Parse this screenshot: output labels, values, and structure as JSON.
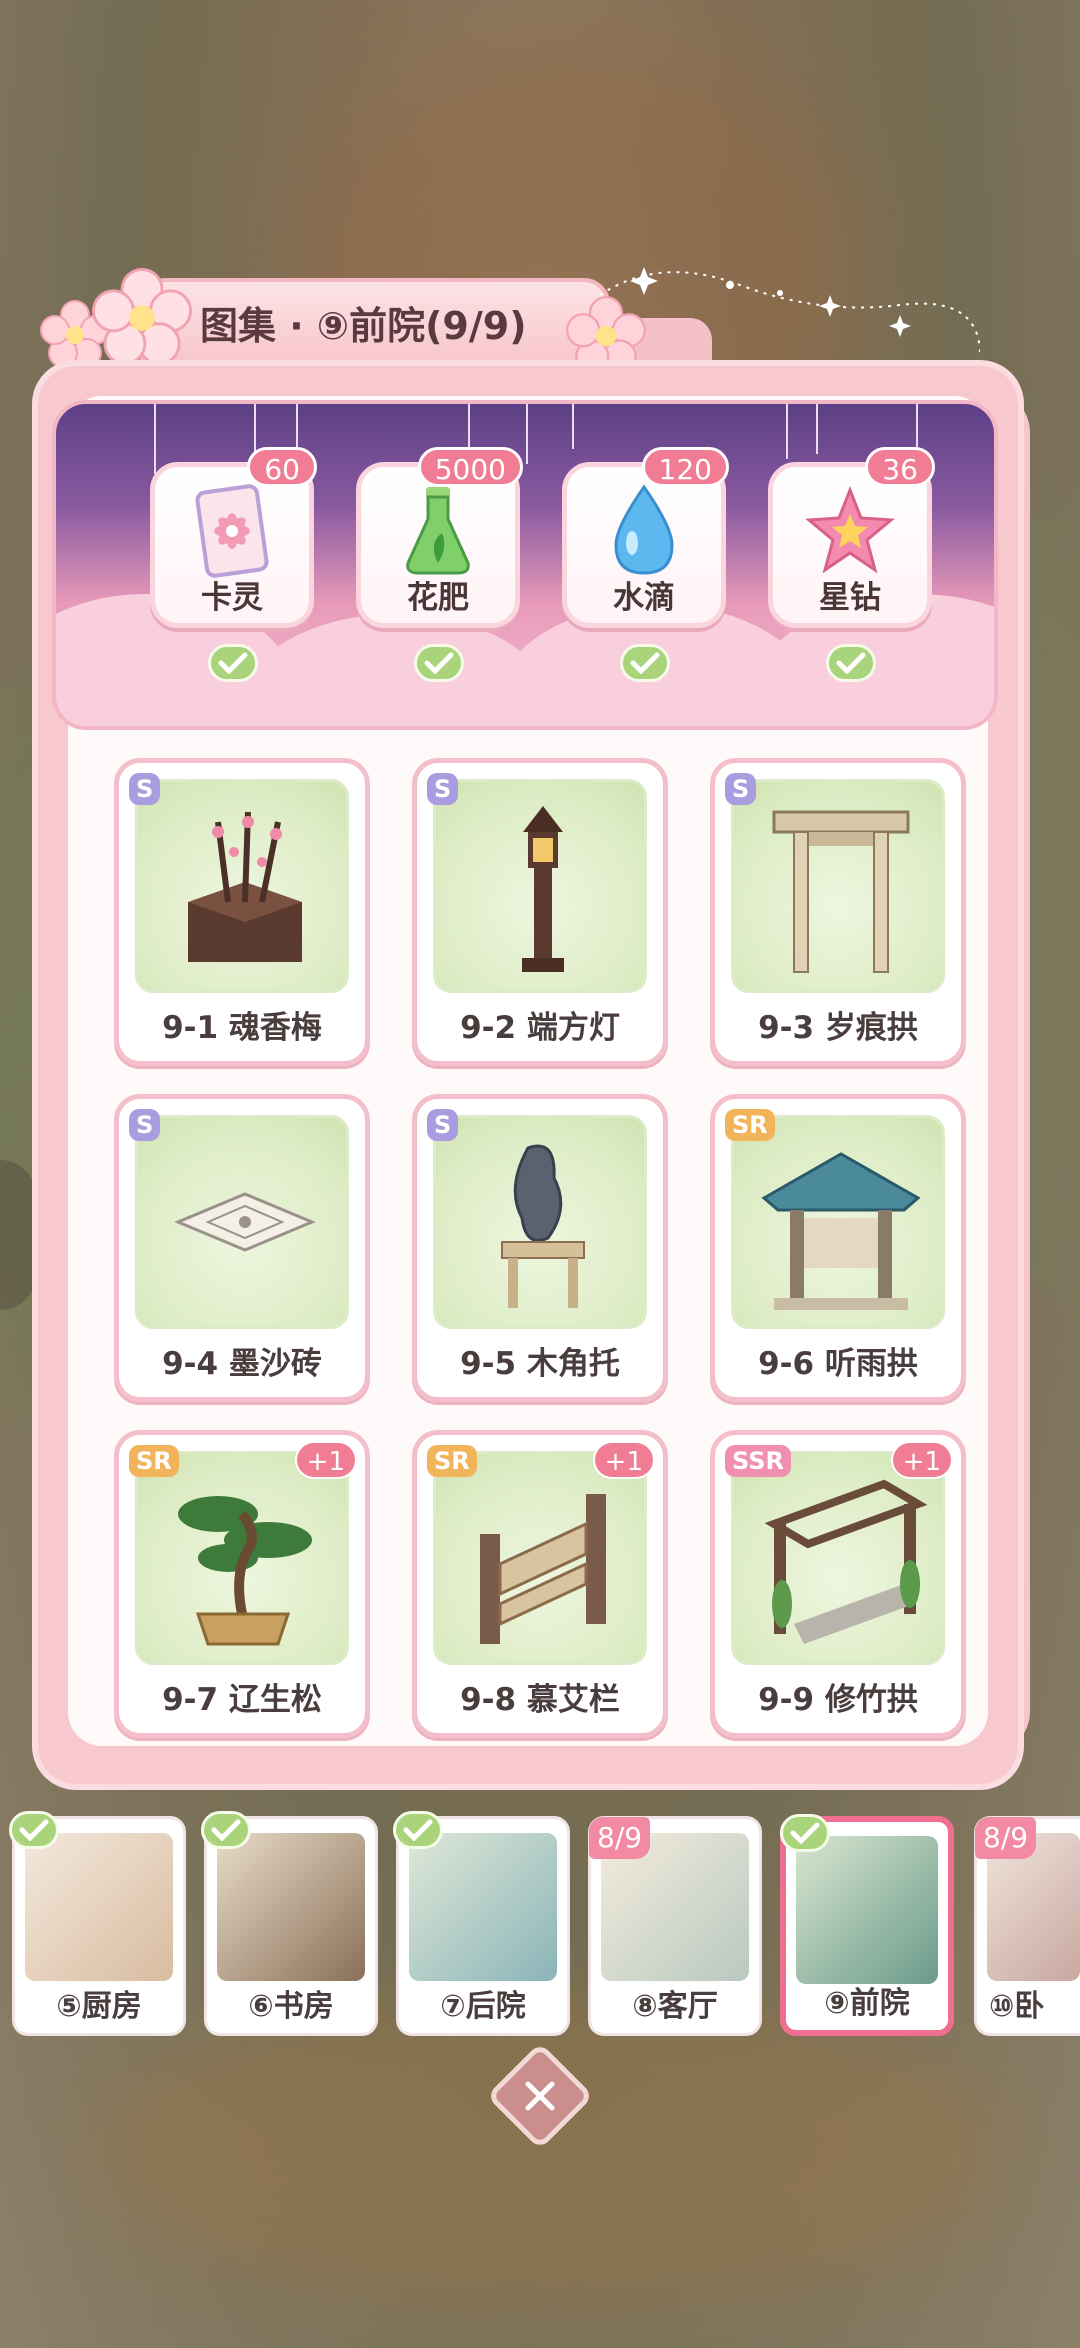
{
  "title": "图集 · ⑨前院(9/9)",
  "rewards": [
    {
      "label": "卡灵",
      "count": "60",
      "icon": "card-icon",
      "claimed": true
    },
    {
      "label": "花肥",
      "count": "5000",
      "icon": "fertilizer-flask-icon",
      "claimed": true
    },
    {
      "label": "水滴",
      "count": "120",
      "icon": "water-drop-icon",
      "claimed": true
    },
    {
      "label": "星钻",
      "count": "36",
      "icon": "star-diamond-icon",
      "claimed": true
    }
  ],
  "items": [
    {
      "name": "9-1 魂香梅",
      "rarity": "S",
      "plus": ""
    },
    {
      "name": "9-2 端方灯",
      "rarity": "S",
      "plus": ""
    },
    {
      "name": "9-3 岁痕拱",
      "rarity": "S",
      "plus": ""
    },
    {
      "name": "9-4 墨沙砖",
      "rarity": "S",
      "plus": ""
    },
    {
      "name": "9-5 木角托",
      "rarity": "S",
      "plus": ""
    },
    {
      "name": "9-6 听雨拱",
      "rarity": "SR",
      "plus": ""
    },
    {
      "name": "9-7 辽生松",
      "rarity": "SR",
      "plus": "+1"
    },
    {
      "name": "9-8 慕艾栏",
      "rarity": "SR",
      "plus": "+1"
    },
    {
      "name": "9-9 修竹拱",
      "rarity": "SSR",
      "plus": "+1"
    }
  ],
  "rooms": [
    {
      "name": "⑤厨房",
      "progress": "",
      "complete": true
    },
    {
      "name": "⑥书房",
      "progress": "",
      "complete": true
    },
    {
      "name": "⑦后院",
      "progress": "",
      "complete": true
    },
    {
      "name": "⑧客厅",
      "progress": "8/9",
      "complete": false
    },
    {
      "name": "⑨前院",
      "progress": "",
      "complete": true,
      "active": true
    },
    {
      "name": "⑩卧",
      "progress": "8/9",
      "complete": false
    }
  ],
  "colors": {
    "accent_pink": "#f17d95",
    "check_green": "#a9d47b",
    "active_border": "#f06f91"
  }
}
